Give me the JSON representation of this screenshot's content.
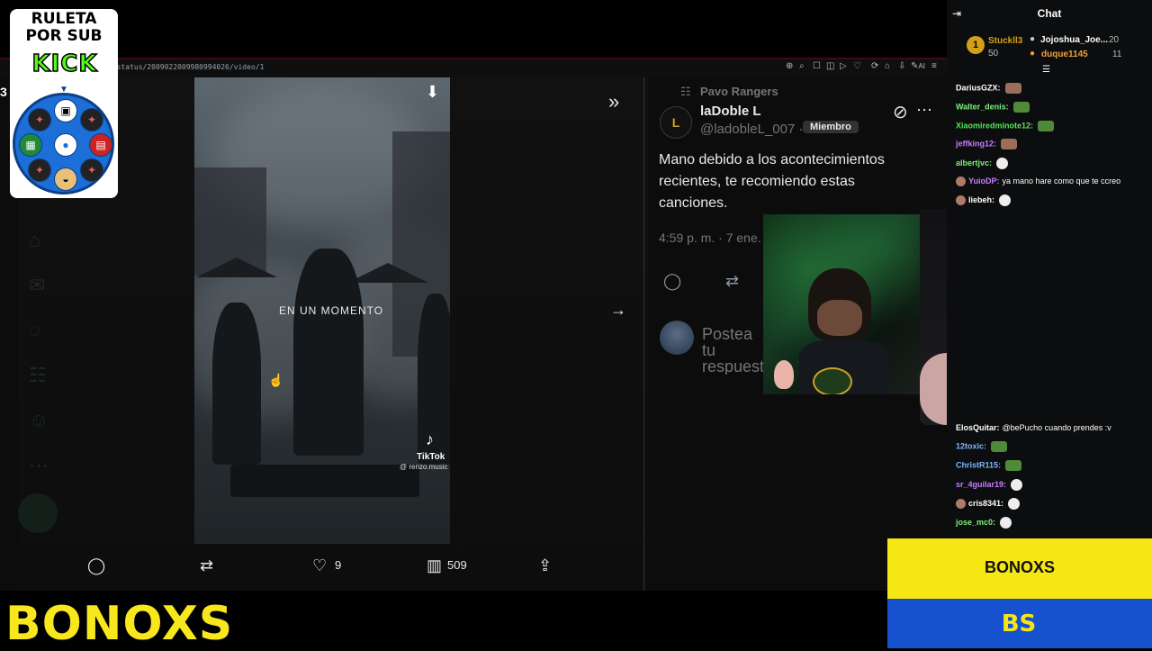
{
  "browser": {
    "url": "7/status/2009022009980994026/video/1",
    "toolbar_ai_label": "AI"
  },
  "video": {
    "caption": "EN UN MOMENTO",
    "tiktok_label": "TikTok",
    "tiktok_user": "@ renzo.music",
    "actions": {
      "likes": "9",
      "views": "509"
    }
  },
  "post": {
    "community": "Pavo Rangers",
    "author_name": "laDoble L",
    "author_handle": "@ladobleL_007 ·",
    "member_badge": "Miembro",
    "avatar_letter": "L",
    "text": "Mano debido a los acontecimientos recientes, te recomiendo estas canciones.",
    "timestamp": "4:59 p. m. · 7 ene.",
    "reply_placeholder": "Postea tu respuesta"
  },
  "ruleta": {
    "title_line1": "RULETA",
    "title_line2": "POR SUB",
    "kick": "KICK",
    "stray_digit": "3"
  },
  "chat": {
    "title": "Chat",
    "leaderboard": [
      {
        "rank": "1",
        "name": "Stuckll3",
        "count": "50",
        "color": "#d4a017"
      },
      {
        "name": "Jojoshua_Joe...",
        "count": "20",
        "color": "#ffffff"
      },
      {
        "name": "duque1145",
        "count": "11",
        "color": "#f0a23a"
      }
    ],
    "messages": [
      {
        "user": "DariusGZX:",
        "text": "",
        "color": "#ffffff",
        "emote": "face"
      },
      {
        "user": "Walter_denis:",
        "text": "",
        "color": "#7cf07c",
        "emote": "pepe"
      },
      {
        "user": "Xiaomiredminote12:",
        "text": "",
        "color": "#55e655",
        "emote": "pepe"
      },
      {
        "user": "jeffking12:",
        "text": "",
        "color": "#c77dff",
        "emote": "face"
      },
      {
        "user": "albertjvc:",
        "text": "",
        "color": "#7cf07c",
        "emote": "skull"
      },
      {
        "user": "YuioDP:",
        "text": "ya mano hare como que te ccreo",
        "color": "#c77dff",
        "emote": ""
      },
      {
        "user": "liebeh:",
        "text": "",
        "color": "#ffffff",
        "emote": "skull"
      },
      {
        "user": "ElosQuitar:",
        "text": "@bePucho cuando prendes :v",
        "color": "#ffffff",
        "emote": ""
      },
      {
        "user": "12toxic:",
        "text": "",
        "color": "#7ab8ff",
        "emote": "pepe"
      },
      {
        "user": "ChristR115:",
        "text": "",
        "color": "#7ab8ff",
        "emote": "pepe"
      },
      {
        "user": "sr_4guilar19:",
        "text": "",
        "color": "#c77dff",
        "emote": "skull"
      },
      {
        "user": "cris8341:",
        "text": "",
        "color": "#ffffff",
        "emote": "skull"
      },
      {
        "user": "jose_mc0:",
        "text": "",
        "color": "#7cf07c",
        "emote": "skull"
      }
    ]
  },
  "brand": {
    "bonoxs_main": "BONOXS",
    "bonoxs_panel": "BONOXS",
    "mini_logo": "BS"
  },
  "colors": {
    "twitter_bg": "#0c0c0c",
    "muted": "#71767b",
    "bonoxs_yellow": "#f5e614",
    "bonoxs_blue": "#1752ce",
    "kick_green": "#53fc18"
  }
}
